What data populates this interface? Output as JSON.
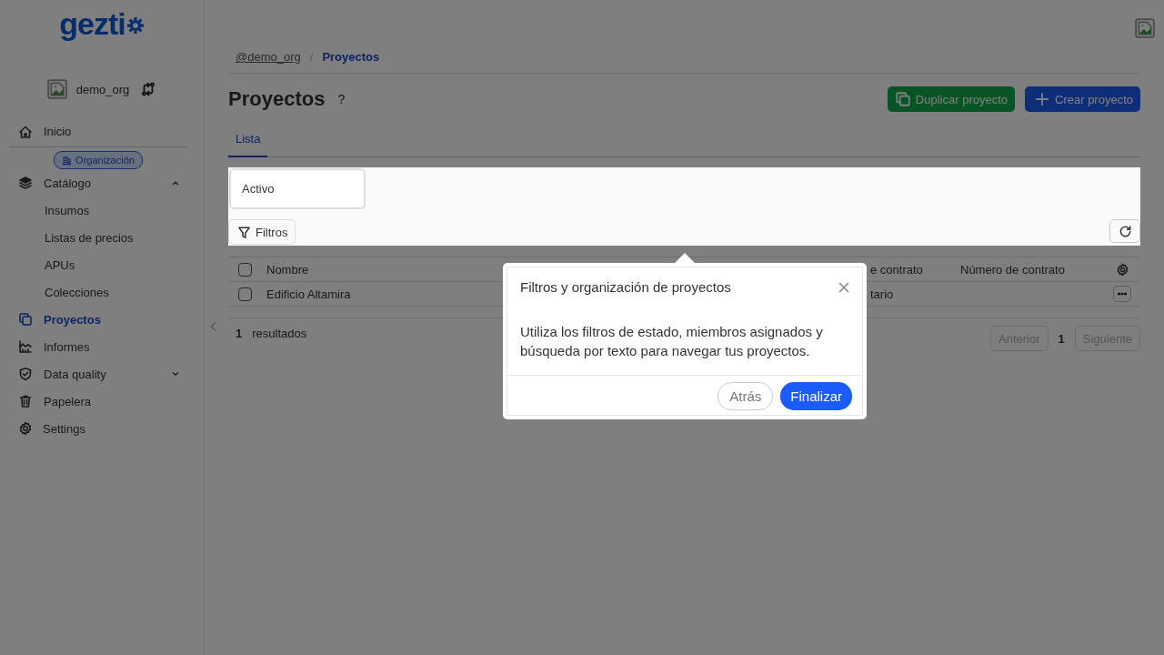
{
  "logo": {
    "text": "gezti"
  },
  "org": {
    "name": "demo_org"
  },
  "sidebar": {
    "top_items": [
      {
        "label": "Inicio",
        "selected": false
      }
    ],
    "section_badge": "Organización",
    "items": [
      {
        "label": "Catálogo",
        "selected": false,
        "expanded": true,
        "children": [
          {
            "label": "Insumos",
            "selected": false
          },
          {
            "label": "Listas de precios",
            "selected": false
          },
          {
            "label": "APUs",
            "selected": false
          },
          {
            "label": "Colecciones",
            "selected": false
          }
        ]
      },
      {
        "label": "Proyectos",
        "selected": true
      },
      {
        "label": "Informes",
        "selected": false
      },
      {
        "label": "Data quality",
        "selected": false,
        "expanded": false
      },
      {
        "label": "Papelera",
        "selected": false
      },
      {
        "label": "Settings",
        "selected": false
      }
    ]
  },
  "breadcrumb": [
    {
      "label": "@demo_org",
      "kind": "link"
    },
    {
      "label": "/",
      "kind": "separator"
    },
    {
      "label": "Proyectos",
      "kind": "current"
    }
  ],
  "page": {
    "title": "Proyectos",
    "help": "?"
  },
  "actions": [
    {
      "label": "Duplicar proyecto",
      "kind": "duplicate"
    },
    {
      "label": "Crear proyecto",
      "kind": "create"
    }
  ],
  "tabs": [
    {
      "label": "Lista",
      "selected": true
    }
  ],
  "filters": {
    "status_value": "Activo",
    "button": "Filtros"
  },
  "table": {
    "columns": [
      {
        "label": "Nombre"
      },
      {
        "label": "e contrato"
      },
      {
        "label": "Número de contrato"
      }
    ],
    "rows": [
      {
        "checked": false,
        "name": "Edificio Altamira",
        "column_2": "tario"
      }
    ],
    "header_checked": false
  },
  "footer": {
    "count": "1",
    "count_label": "resultados"
  },
  "pagination": {
    "previous": {
      "label": "Anterior",
      "disabled": true
    },
    "page": "1",
    "next": {
      "label": "Siguiente",
      "disabled": true
    }
  },
  "popover": {
    "title": "Filtros y organización de proyectos",
    "body": "Utiliza los filtros de estado, miembros asignados y búsqueda por texto para navegar tus proyectos.",
    "back": "Atrás",
    "finish": "Finalizar"
  }
}
